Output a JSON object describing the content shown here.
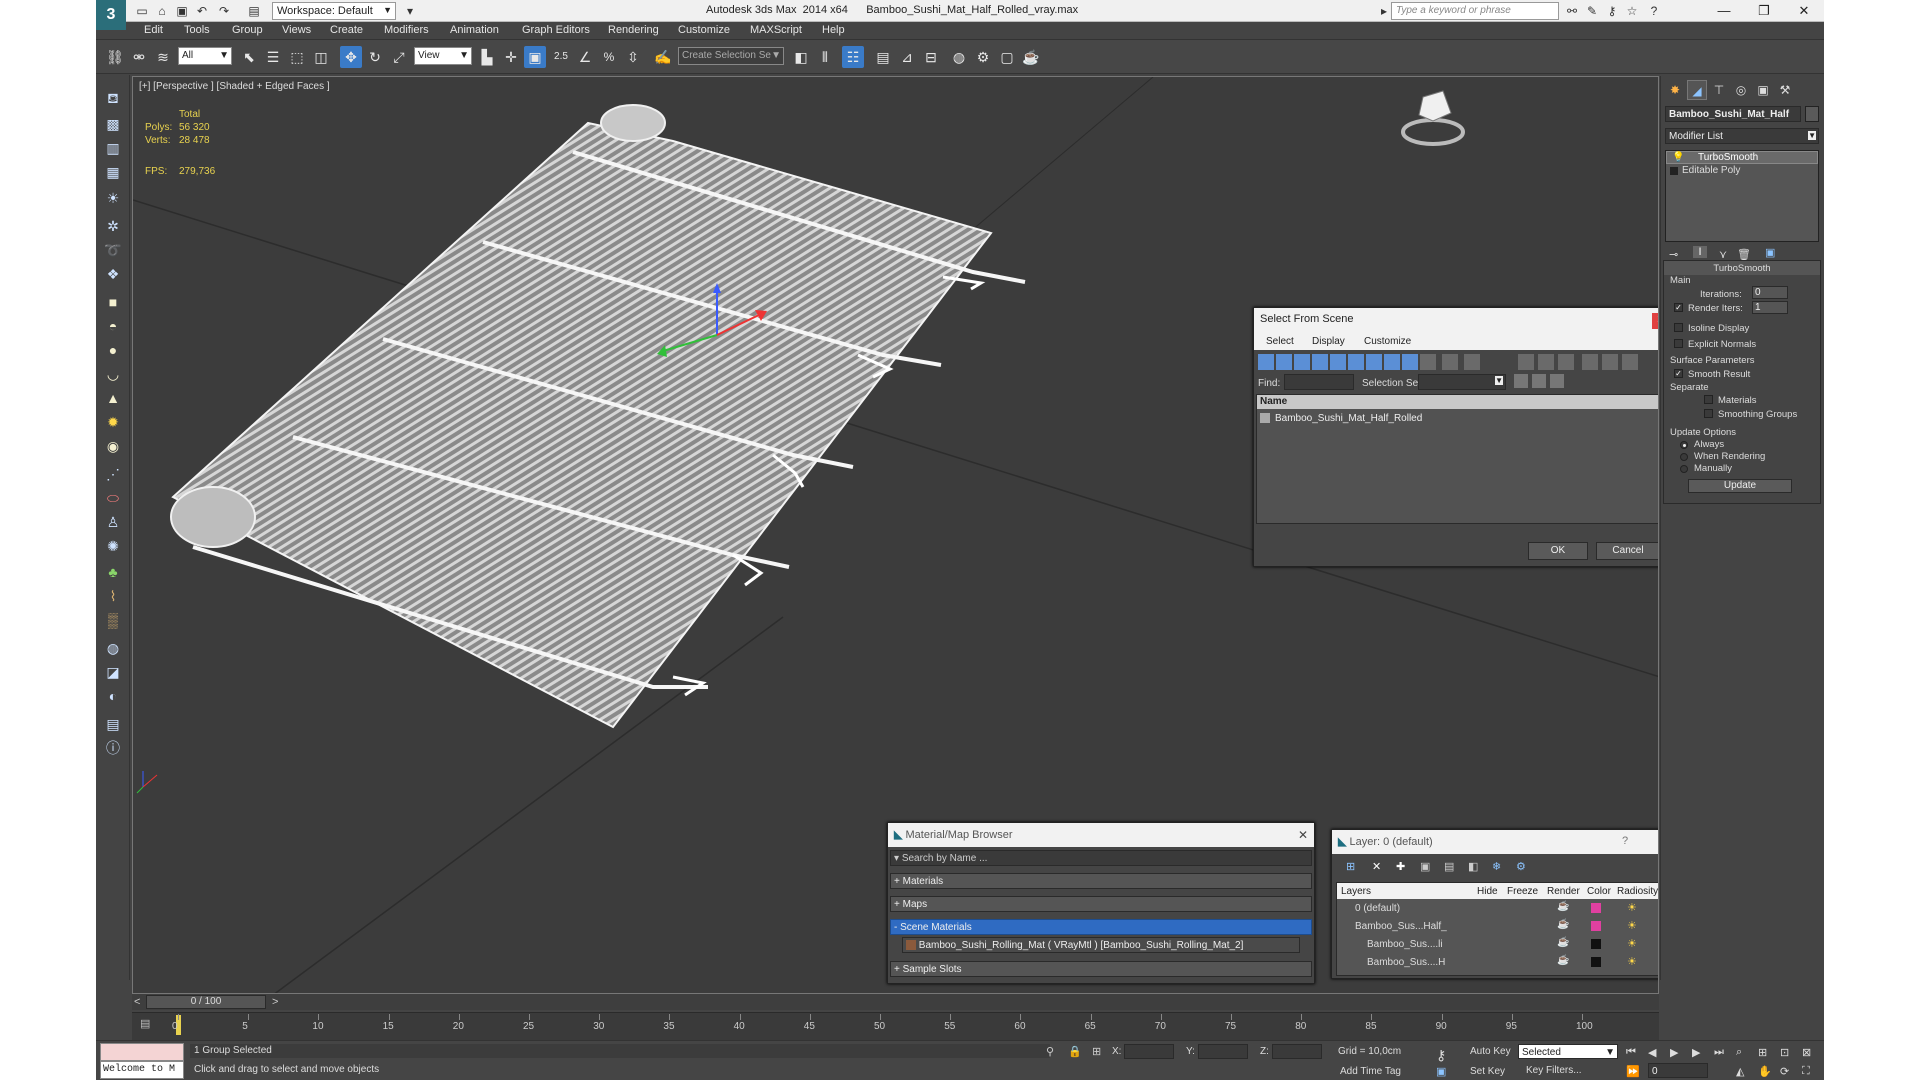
{
  "titlebar": {
    "app": "Autodesk 3ds Max  2014 x64",
    "file": "Bamboo_Sushi_Mat_Half_Rolled_vray.max",
    "workspace": "Workspace: Default",
    "search_placeholder": "Type a keyword or phrase"
  },
  "menu": [
    "Edit",
    "Tools",
    "Group",
    "Views",
    "Create",
    "Modifiers",
    "Animation",
    "Graph Editors",
    "Rendering",
    "Customize",
    "MAXScript",
    "Help"
  ],
  "toolbar": {
    "selection_filter": "All",
    "ref_coord": "View",
    "named_selection": "Create Selection Se",
    "snap_label": "2.5",
    "percent_label": "%"
  },
  "viewport": {
    "label": "[+] [Perspective ] [Shaded + Edged Faces ]",
    "stats": {
      "total_label": "Total",
      "polys_label": "Polys:",
      "polys": "56 320",
      "verts_label": "Verts:",
      "verts": "28 478",
      "fps_label": "FPS:",
      "fps": "279,736"
    }
  },
  "command_panel": {
    "object_name": "Bamboo_Sushi_Mat_Half",
    "modifier_list": "Modifier List",
    "stack": [
      "TurboSmooth",
      "Editable Poly"
    ],
    "rollout_title": "TurboSmooth",
    "main_label": "Main",
    "iterations_label": "Iterations:",
    "iterations": "0",
    "render_iters_label": "Render Iters:",
    "render_iters": "1",
    "isoline": "Isoline Display",
    "explicit": "Explicit Normals",
    "surface_params": "Surface Parameters",
    "smooth_result": "Smooth Result",
    "separate": "Separate",
    "materials": "Materials",
    "smoothing_groups": "Smoothing Groups",
    "update_options": "Update Options",
    "always": "Always",
    "when_rendering": "When Rendering",
    "manually": "Manually",
    "update_btn": "Update"
  },
  "select_from_scene": {
    "title": "Select From Scene",
    "menu": [
      "Select",
      "Display",
      "Customize"
    ],
    "find_label": "Find:",
    "selection_set_label": "Selection Set:",
    "column_name": "Name",
    "items": [
      "Bamboo_Sushi_Mat_Half_Rolled"
    ],
    "ok": "OK",
    "cancel": "Cancel",
    "close": "x"
  },
  "material_browser": {
    "title": "Material/Map Browser",
    "search_placeholder": "Search by Name ...",
    "sections": [
      "+ Materials",
      "+ Maps",
      "- Scene Materials",
      "+ Sample Slots"
    ],
    "scene_item": "Bamboo_Sushi_Rolling_Mat ( VRayMtl ) [Bamboo_Sushi_Rolling_Mat_2]"
  },
  "layer_manager": {
    "title": "Layer: 0 (default)",
    "help": "?",
    "columns": [
      "Layers",
      "Hide",
      "Freeze",
      "Render",
      "Color",
      "Radiosity"
    ],
    "rows": [
      {
        "name": "0 (default)",
        "color": "#e040a0"
      },
      {
        "name": "Bamboo_Sus...Half_",
        "color": "#e040a0"
      },
      {
        "name": "Bamboo_Sus....li",
        "color": "#111111"
      },
      {
        "name": "Bamboo_Sus....H",
        "color": "#111111"
      }
    ]
  },
  "timeline": {
    "frame": "0 / 100",
    "ticks": [
      "0",
      "5",
      "10",
      "15",
      "20",
      "25",
      "30",
      "35",
      "40",
      "45",
      "50",
      "55",
      "60",
      "65",
      "70",
      "75",
      "80",
      "85",
      "90",
      "95",
      "100"
    ]
  },
  "status": {
    "maxscript": "Welcome to M",
    "selection": "1 Group Selected",
    "prompt": "Click and drag to select and move objects",
    "x_label": "X:",
    "y_label": "Y:",
    "z_label": "Z:",
    "grid": "Grid = 10,0cm",
    "add_time_tag": "Add Time Tag",
    "auto_key": "Auto Key",
    "set_key": "Set Key",
    "key_mode": "Selected",
    "key_filters": "Key Filters...",
    "frame_field": "0"
  }
}
